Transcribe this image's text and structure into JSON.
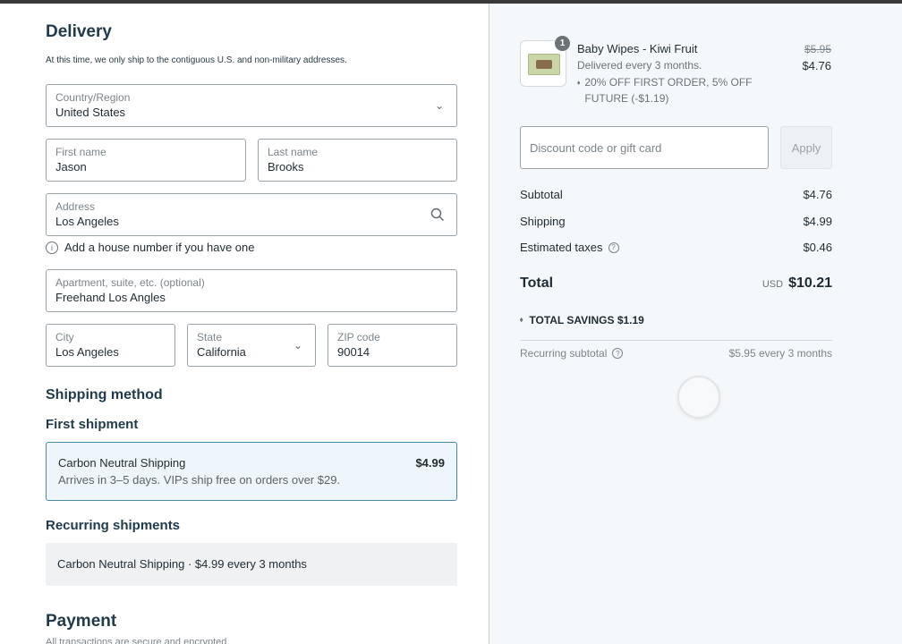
{
  "delivery": {
    "title": "Delivery",
    "note": "At this time, we only ship to the contiguous U.S. and non-military addresses.",
    "country": {
      "label": "Country/Region",
      "value": "United States"
    },
    "first_name": {
      "label": "First name",
      "value": "Jason"
    },
    "last_name": {
      "label": "Last name",
      "value": "Brooks"
    },
    "address": {
      "label": "Address",
      "value": "Los Angeles"
    },
    "address_hint": "Add a house number if you have one",
    "apartment": {
      "label": "Apartment, suite, etc. (optional)",
      "value": "Freehand Los Angles"
    },
    "city": {
      "label": "City",
      "value": "Los Angeles"
    },
    "state": {
      "label": "State",
      "value": "California"
    },
    "zip": {
      "label": "ZIP code",
      "value": "90014"
    }
  },
  "shipping": {
    "title": "Shipping method",
    "first_title": "First shipment",
    "option_name": "Carbon Neutral Shipping",
    "option_price": "$4.99",
    "option_desc": "Arrives in 3–5 days. VIPs ship free on orders over $29.",
    "recurring_title": "Recurring shipments",
    "recurring_text": "Carbon Neutral Shipping · $4.99 every 3 months"
  },
  "payment": {
    "title": "Payment",
    "note": "All transactions are secure and encrypted."
  },
  "summary": {
    "item": {
      "quantity": "1",
      "name": "Baby Wipes - Kiwi Fruit",
      "frequency": "Delivered every 3 months.",
      "discount": "20% OFF FIRST ORDER, 5% OFF FUTURE (-$1.19)",
      "old_price": "$5.95",
      "price": "$4.76"
    },
    "discount_placeholder": "Discount code or gift card",
    "apply_label": "Apply",
    "subtotal_label": "Subtotal",
    "subtotal": "$4.76",
    "shipping_label": "Shipping",
    "shipping": "$4.99",
    "taxes_label": "Estimated taxes",
    "taxes": "$0.46",
    "total_label": "Total",
    "currency": "USD",
    "total": "$10.21",
    "savings": "TOTAL SAVINGS  $1.19",
    "recurring_label": "Recurring subtotal",
    "recurring_value": "$5.95 every 3 months"
  }
}
